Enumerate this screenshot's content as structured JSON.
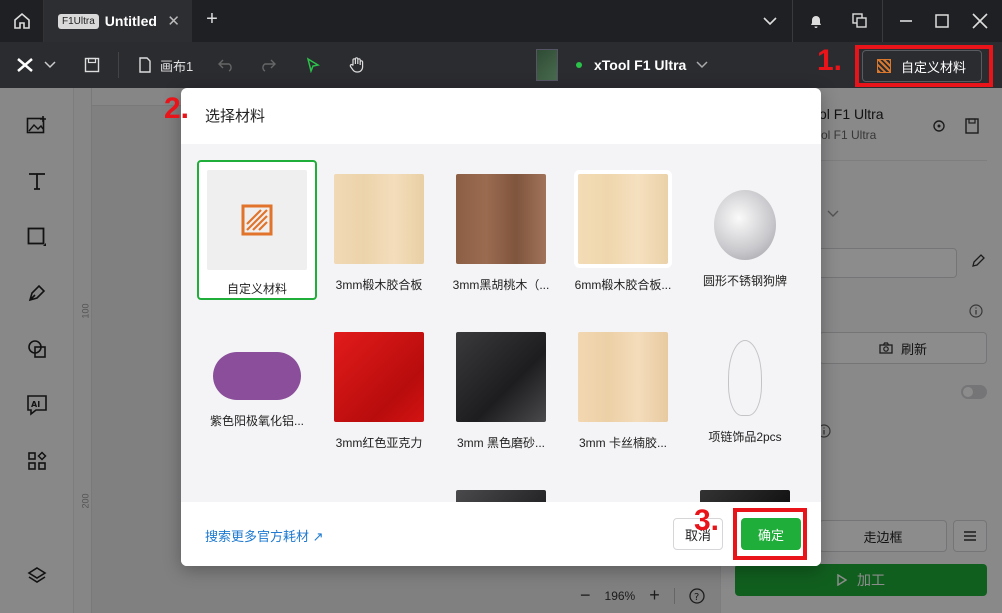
{
  "app": {
    "tab_badge": "F1Ultra",
    "tab_title": "Untitled",
    "tab_close": "✕",
    "new_tab": "+"
  },
  "toolbar": {
    "canvas_name": "画布1",
    "machine_name": "xTool F1 Ultra",
    "custom_material_label": "自定义材料"
  },
  "annotations": {
    "step1": "1.",
    "step2": "2.",
    "step3": "3."
  },
  "canvas": {
    "ruler_marks": [
      "100",
      "200"
    ],
    "zoom": "196%"
  },
  "right_panel": {
    "title": "ol F1 Ultra",
    "subtitle": "ol F1 Ultra",
    "refresh_label": "刷新",
    "frame_label": "走边框",
    "process_label": "加工"
  },
  "modal": {
    "title": "选择材料",
    "items": [
      {
        "label": "自定义材料",
        "kind": "custom",
        "selected": true
      },
      {
        "label": "3mm椴木胶合板",
        "kind": "basswood"
      },
      {
        "label": "3mm黑胡桃木（...",
        "kind": "walnut"
      },
      {
        "label": "6mm椴木胶合板...",
        "kind": "basswood2"
      },
      {
        "label": "圆形不锈钢狗牌",
        "kind": "round-tag"
      },
      {
        "label": "紫色阳极氧化铝...",
        "kind": "purple-bone"
      },
      {
        "label": "3mm红色亚克力",
        "kind": "red-acrylic"
      },
      {
        "label": "3mm 黑色磨砂...",
        "kind": "black-matte"
      },
      {
        "label": "3mm 卡丝楠胶...",
        "kind": "kasnan"
      },
      {
        "label": "项链饰品2pcs",
        "kind": "necklace"
      },
      {
        "label": "",
        "kind": "green-bone"
      },
      {
        "label": "",
        "kind": "heart-tag"
      },
      {
        "label": "",
        "kind": "dark-sheet"
      },
      {
        "label": "",
        "kind": "dark-card"
      },
      {
        "label": "",
        "kind": "black-card"
      }
    ],
    "search_more": "搜索更多官方耗材 ↗",
    "cancel_label": "取消",
    "ok_label": "确定"
  },
  "colors": {
    "accent_green": "#1fae3a",
    "highlight_red": "#e8141a",
    "link_blue": "#1e7ad0"
  }
}
